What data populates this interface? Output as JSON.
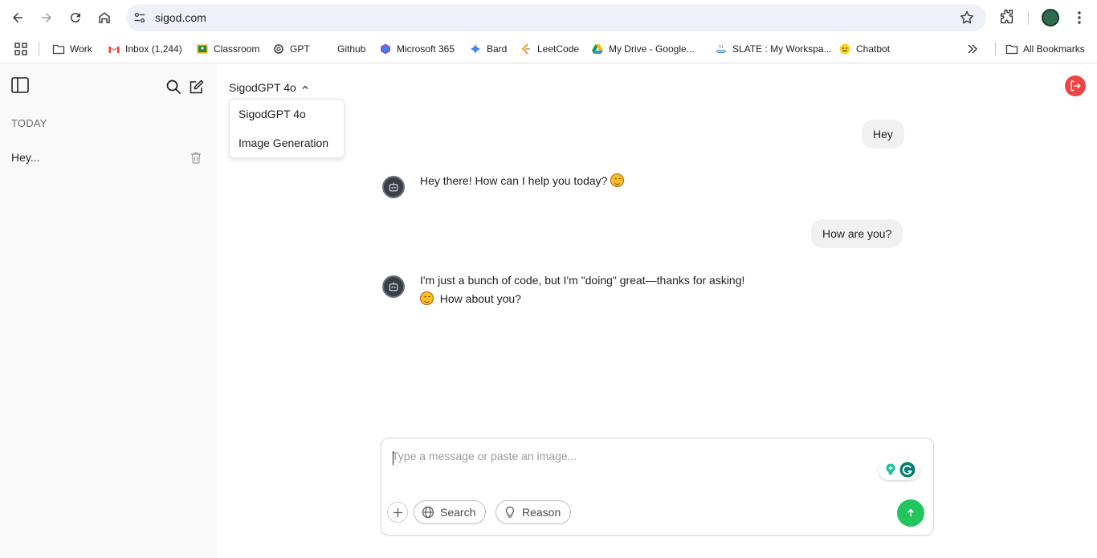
{
  "browser": {
    "url": "sigod.com",
    "bookmarks": [
      {
        "label": "Work",
        "icon": "folder-icon"
      },
      {
        "label": "Inbox (1,244)",
        "icon": "gmail-icon"
      },
      {
        "label": "Classroom",
        "icon": "classroom-icon"
      },
      {
        "label": "GPT",
        "icon": "openai-icon"
      },
      {
        "label": "Github",
        "icon": "github-icon"
      },
      {
        "label": "Microsoft 365",
        "icon": "microsoft365-icon"
      },
      {
        "label": "Bard",
        "icon": "sparkle-icon"
      },
      {
        "label": "LeetCode",
        "icon": "leetcode-icon"
      },
      {
        "label": "My Drive - Google...",
        "icon": "drive-icon"
      },
      {
        "label": "SLATE : My Workspa...",
        "icon": "slate-icon"
      },
      {
        "label": "Chatbot",
        "icon": "hugging-face-icon"
      }
    ],
    "all_bookmarks": "All Bookmarks"
  },
  "sidebar": {
    "section": "TODAY",
    "chats": [
      {
        "title": "Hey..."
      }
    ]
  },
  "header": {
    "model": "SigodGPT 4o",
    "dropdown_options": [
      "SigodGPT 4o",
      "Image Generation"
    ]
  },
  "messages": [
    {
      "role": "user",
      "text": "Hey"
    },
    {
      "role": "assistant",
      "text": "Hey there! How can I help you today?"
    },
    {
      "role": "user",
      "text": "How are you?"
    },
    {
      "role": "assistant",
      "line1": "I'm just a bunch of code, but I'm \"doing\" great—thanks for asking!",
      "line2": "How about you?"
    }
  ],
  "composer": {
    "placeholder": "Type a message or paste an image...",
    "search_label": "Search",
    "reason_label": "Reason"
  },
  "colors": {
    "send": "#22c55e",
    "logout": "#ef4444",
    "sidebar_bg": "#f9f9f9"
  }
}
